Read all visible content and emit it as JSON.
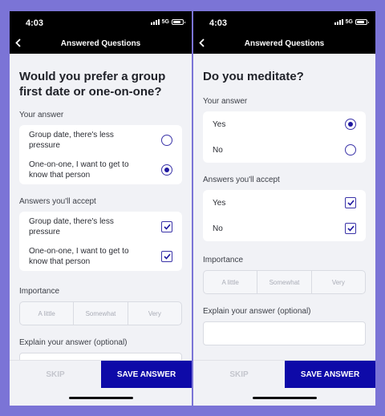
{
  "status_bar": {
    "time": "4:03",
    "network": "5G"
  },
  "nav_title": "Answered Questions",
  "screens": [
    {
      "question": "Would you prefer a group first date or one-on-one?",
      "your_answer_label": "Your answer",
      "answers": [
        {
          "label": "Group date, there's less pressure",
          "selected": false
        },
        {
          "label": "One-on-one, I want to get to know that person",
          "selected": true
        }
      ],
      "accept_label": "Answers you'll accept",
      "accepted": [
        {
          "label": "Group date, there's less pressure",
          "checked": true
        },
        {
          "label": "One-on-one, I want to get to know that person",
          "checked": true
        }
      ],
      "importance_label": "Importance",
      "importance_options": [
        "A little",
        "Somewhat",
        "Very"
      ],
      "explain_label": "Explain your answer (optional)"
    },
    {
      "question": "Do you meditate?",
      "your_answer_label": "Your answer",
      "answers": [
        {
          "label": "Yes",
          "selected": true
        },
        {
          "label": "No",
          "selected": false
        }
      ],
      "accept_label": "Answers you'll accept",
      "accepted": [
        {
          "label": "Yes",
          "checked": true
        },
        {
          "label": "No",
          "checked": true
        }
      ],
      "importance_label": "Importance",
      "importance_options": [
        "A little",
        "Somewhat",
        "Very"
      ],
      "explain_label": "Explain your answer (optional)"
    }
  ],
  "buttons": {
    "skip": "SKIP",
    "save": "SAVE ANSWER"
  },
  "colors": {
    "accent": "#0e0aa8",
    "background": "#7b74d6",
    "header": "#000000"
  }
}
